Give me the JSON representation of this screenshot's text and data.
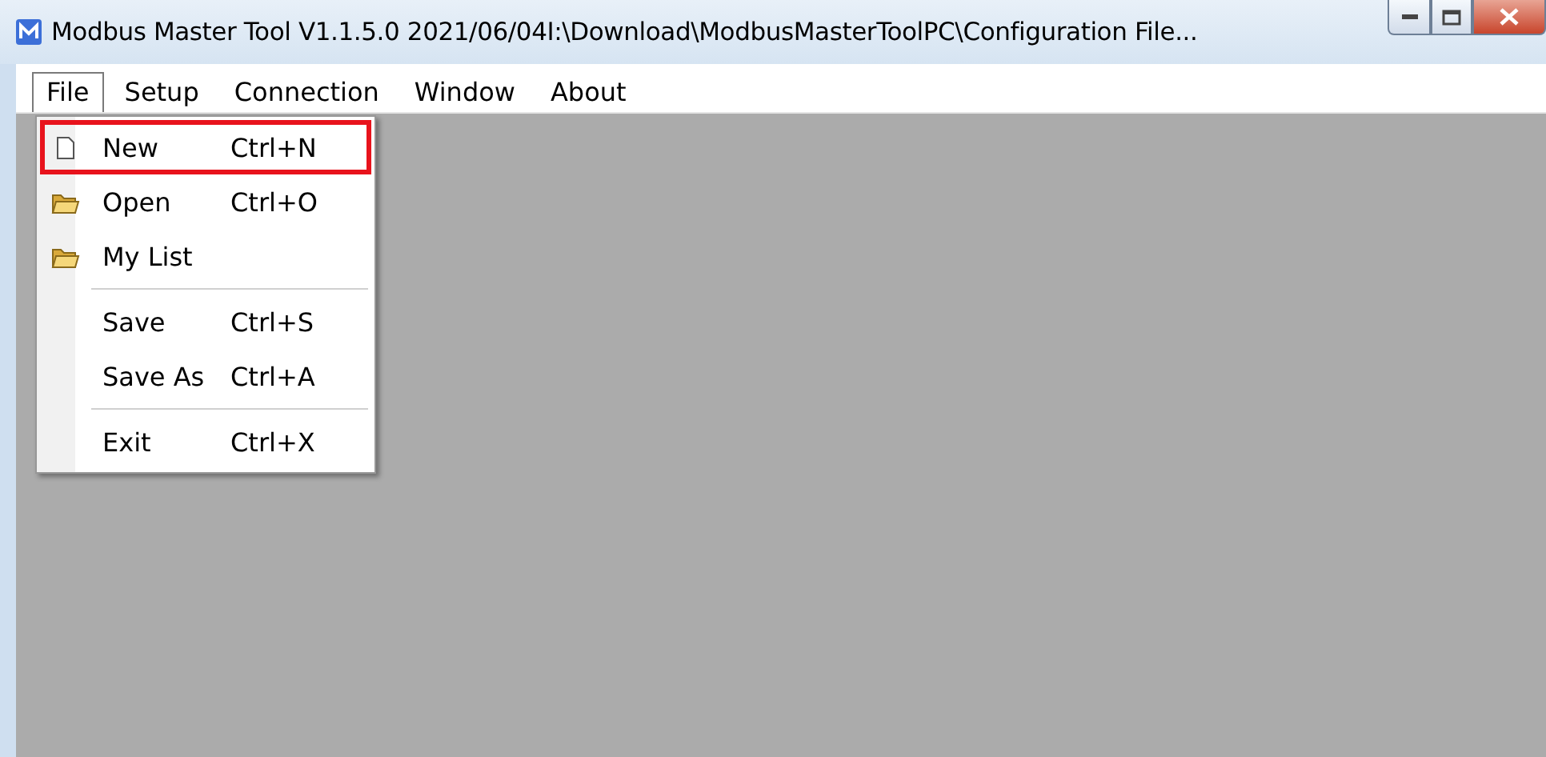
{
  "window": {
    "title": "Modbus Master Tool V1.1.5.0  2021/06/04I:\\Download\\ModbusMasterToolPC\\Configuration File..."
  },
  "menu_bar": [
    {
      "label": "File",
      "selected": true
    },
    {
      "label": "Setup",
      "selected": false
    },
    {
      "label": "Connection",
      "selected": false
    },
    {
      "label": "Window",
      "selected": false
    },
    {
      "label": "About",
      "selected": false
    }
  ],
  "file_menu": [
    [
      {
        "label": "New",
        "shortcut": "Ctrl+N",
        "kind": "page",
        "highlighted": true
      },
      {
        "label": "Open",
        "shortcut": "Ctrl+O",
        "kind": "folder",
        "highlighted": false
      },
      {
        "label": "My List",
        "kind": "folder",
        "highlighted": false
      }
    ],
    [
      {
        "label": "Save",
        "shortcut": "Ctrl+S",
        "highlighted": false
      },
      {
        "label": "Save As",
        "shortcut": "Ctrl+A",
        "highlighted": false
      }
    ],
    [
      {
        "label": "Exit",
        "shortcut": "Ctrl+X",
        "highlighted": false
      }
    ]
  ]
}
